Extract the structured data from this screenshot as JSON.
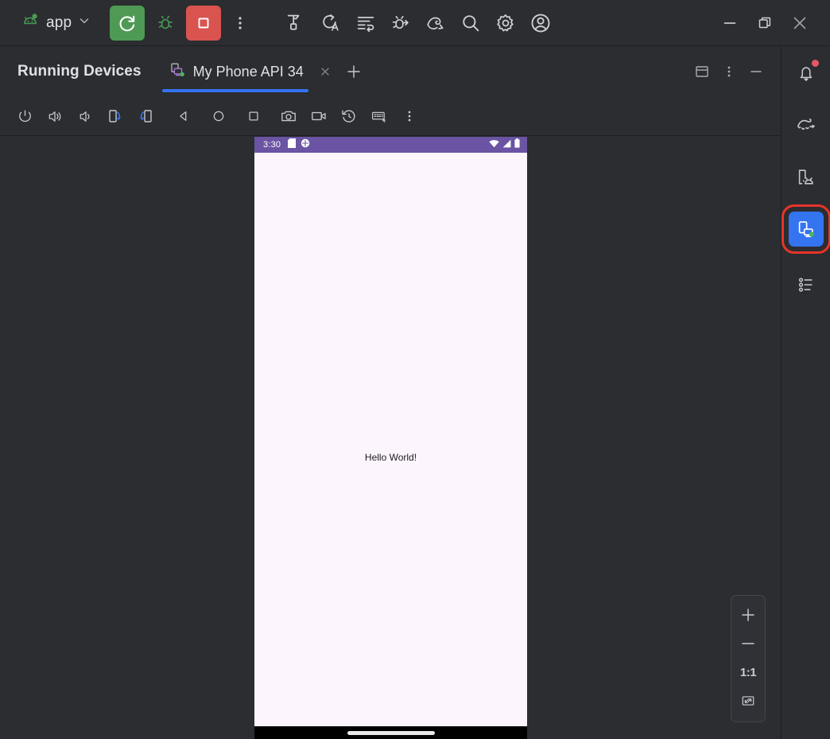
{
  "main_toolbar": {
    "run_config": {
      "icon": "android-robot-icon",
      "label": "app",
      "chevron": "chevron-down-icon"
    },
    "buttons": [
      {
        "name": "run-button",
        "icon": "run-refresh-icon",
        "style": "green"
      },
      {
        "name": "debug-button",
        "icon": "bug-icon",
        "style": "plain"
      },
      {
        "name": "stop-button",
        "icon": "stop-square-icon",
        "style": "red"
      },
      {
        "name": "more-actions-button",
        "icon": "vertical-dots-icon",
        "style": "plain"
      },
      {
        "name": "build-button",
        "icon": "hammer-icon",
        "style": "plain"
      },
      {
        "name": "apply-changes-button",
        "icon": "apply-changes-icon",
        "style": "plain"
      },
      {
        "name": "apply-code-changes-button",
        "icon": "apply-code-changes-icon",
        "style": "plain"
      },
      {
        "name": "debug-attach-button",
        "icon": "bug-attach-icon",
        "style": "plain"
      },
      {
        "name": "profiler-button",
        "icon": "profiler-icon",
        "style": "plain"
      },
      {
        "name": "search-button",
        "icon": "search-icon",
        "style": "plain"
      },
      {
        "name": "settings-button",
        "icon": "gear-icon",
        "style": "plain"
      },
      {
        "name": "account-button",
        "icon": "account-circle-icon",
        "style": "plain"
      }
    ],
    "window_controls": [
      {
        "name": "window-minimize-button",
        "icon": "minimize-icon"
      },
      {
        "name": "window-restore-button",
        "icon": "restore-icon"
      },
      {
        "name": "window-close-button",
        "icon": "close-icon"
      }
    ]
  },
  "panel": {
    "title": "Running Devices",
    "tabs": [
      {
        "label": "My Phone API 34",
        "icon": "device-mirror-icon",
        "active": true,
        "close_icon": "close-icon"
      }
    ],
    "add_tab_icon": "plus-icon",
    "actions": [
      {
        "name": "layout-settings-button",
        "icon": "window-layout-icon"
      },
      {
        "name": "panel-options-button",
        "icon": "vertical-dots-icon"
      },
      {
        "name": "hide-panel-button",
        "icon": "minimize-icon"
      }
    ]
  },
  "device_toolbar": [
    {
      "name": "power-button",
      "icon": "power-icon"
    },
    {
      "name": "volume-up-button",
      "icon": "volume-up-icon"
    },
    {
      "name": "volume-down-button",
      "icon": "volume-down-icon"
    },
    {
      "name": "rotate-left-button",
      "icon": "rotate-left-icon"
    },
    {
      "name": "rotate-right-button",
      "icon": "rotate-right-icon"
    },
    {
      "name": "back-button",
      "icon": "back-triangle-icon"
    },
    {
      "name": "home-button",
      "icon": "home-circle-icon"
    },
    {
      "name": "overview-button",
      "icon": "overview-square-icon"
    },
    {
      "name": "screenshot-button",
      "icon": "camera-icon"
    },
    {
      "name": "screen-record-button",
      "icon": "video-camera-icon"
    },
    {
      "name": "device-history-button",
      "icon": "history-rotate-icon"
    },
    {
      "name": "hardware-input-button",
      "icon": "keyboard-icon"
    },
    {
      "name": "device-more-button",
      "icon": "vertical-dots-icon"
    }
  ],
  "device": {
    "status_bar": {
      "time": "3:30",
      "left_icons": [
        "sd-card-icon",
        "debug-circle-icon"
      ],
      "right_icons": [
        "wifi-icon",
        "cellular-signal-icon",
        "battery-icon"
      ],
      "background_color": "#6A54A3"
    },
    "app_screen": {
      "background_color": "#FDF5FD",
      "text": "Hello World!"
    },
    "nav_bar": {
      "gesture_pill": true,
      "background_color": "#000000"
    }
  },
  "zoom_control": {
    "zoom_in_icon": "plus-icon",
    "zoom_out_icon": "minus-icon",
    "actual_size_label": "1:1",
    "fit_to_screen_icon": "fit-screen-icon"
  },
  "right_sidebar": [
    {
      "name": "sidebar-notifications",
      "icon": "bell-icon",
      "badge": true,
      "selected": false,
      "highlighted": false
    },
    {
      "name": "sidebar-gradle",
      "icon": "gradle-elephant-icon",
      "badge": false,
      "selected": false,
      "highlighted": false
    },
    {
      "name": "sidebar-device-manager",
      "icon": "device-manager-icon",
      "badge": false,
      "selected": false,
      "highlighted": false
    },
    {
      "name": "sidebar-running-devices",
      "icon": "running-devices-icon",
      "badge": false,
      "selected": true,
      "highlighted": true
    },
    {
      "name": "sidebar-logcat",
      "icon": "logcat-list-icon",
      "badge": false,
      "selected": false,
      "highlighted": false
    }
  ],
  "colors": {
    "accent_blue": "#3574F0",
    "run_green": "#4E9A55",
    "stop_red": "#D9544F",
    "highlight_red": "#E8342A",
    "toolbar_bg": "#2B2D30",
    "window_bg": "#1E1F22",
    "status_purple": "#6A54A3",
    "app_bg": "#FDF5FD"
  }
}
